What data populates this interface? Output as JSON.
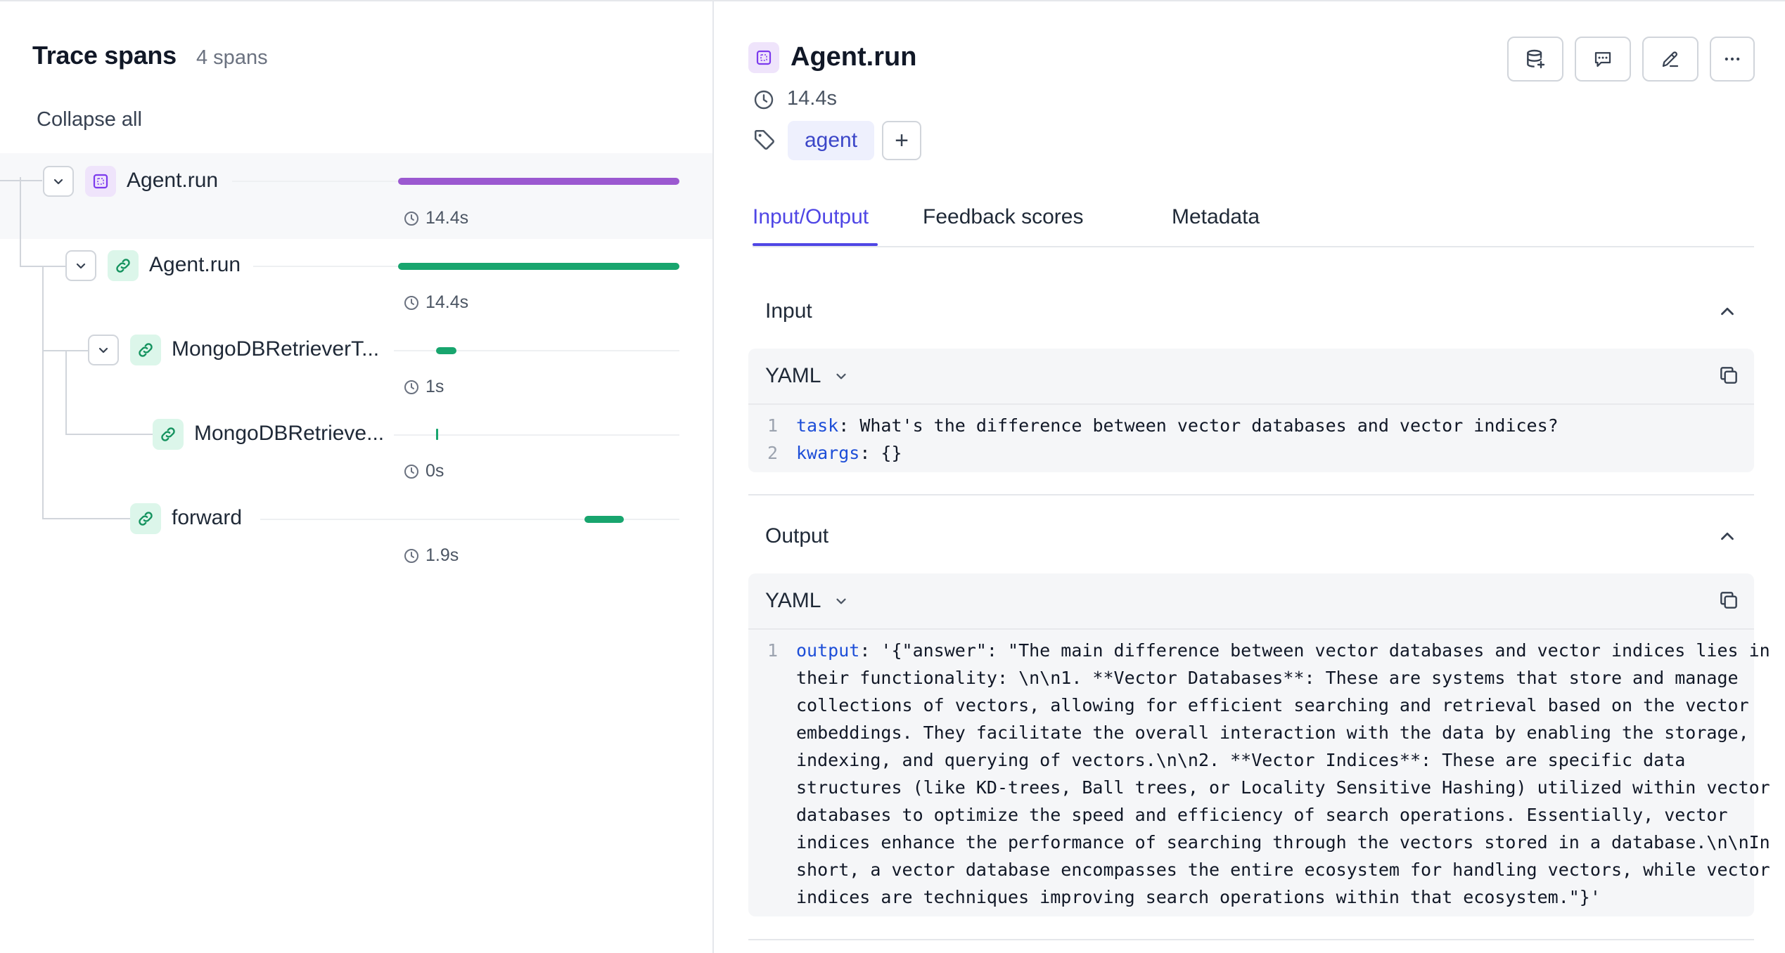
{
  "trace": {
    "title": "Trace spans",
    "count": "4 spans",
    "collapse_label": "Collapse all",
    "spans": [
      {
        "name": "Agent.run",
        "duration": "14.4s",
        "color": "#9b59d0",
        "icon": "span-box-icon"
      },
      {
        "name": "Agent.run",
        "duration": "14.4s",
        "color": "#18a56e",
        "icon": "link-icon"
      },
      {
        "name": "MongoDBRetrieverT...",
        "duration": "1s",
        "color": "#18a56e",
        "icon": "link-icon"
      },
      {
        "name": "MongoDBRetrieve...",
        "duration": "0s",
        "color": "#18a56e",
        "icon": "link-icon"
      },
      {
        "name": "forward",
        "duration": "1.9s",
        "color": "#18a56e",
        "icon": "link-icon"
      }
    ]
  },
  "detail": {
    "title": "Agent.run",
    "duration": "14.4s",
    "tags": [
      "agent"
    ],
    "add_tag_label": "+",
    "tabs": [
      {
        "label": "Input/Output",
        "active": true
      },
      {
        "label": "Feedback scores",
        "active": false
      },
      {
        "label": "Metadata",
        "active": false
      }
    ],
    "input": {
      "title": "Input",
      "format": "YAML",
      "lines": [
        {
          "n": "1",
          "key": "task",
          "rest": ": What's the difference between vector databases and vector indices?"
        },
        {
          "n": "2",
          "key": "kwargs",
          "rest": ": {}"
        }
      ]
    },
    "output": {
      "title": "Output",
      "format": "YAML",
      "line_number": "1",
      "key": "output",
      "wrapped": [
        ": '{\"answer\": \"The main difference between vector databases and vector indices lies in",
        "their functionality: \\n\\n1. **Vector Databases**: These are systems that store and manage",
        "collections of vectors, allowing for efficient searching and retrieval based on the vector",
        "embeddings. They facilitate the overall interaction with the data by enabling the storage,",
        "indexing, and querying of vectors.\\n\\n2. **Vector Indices**: These are specific data",
        "structures (like KD-trees, Ball trees, or Locality Sensitive Hashing) utilized within vector",
        "databases to optimize the speed and efficiency of search operations. Essentially, vector",
        "indices enhance the performance of searching through the vectors stored in a database.\\n\\nIn",
        "short, a vector database encompasses the entire ecosystem for handling vectors, while vector",
        "indices are techniques improving search operations within that ecosystem.\"}'"
      ]
    }
  },
  "theme": {
    "accent": "#4f46e5",
    "span_purple": "#9b59d0",
    "span_green": "#18a56e",
    "tag_bg": "#eef0fd",
    "tag_text": "#3b46c8"
  }
}
